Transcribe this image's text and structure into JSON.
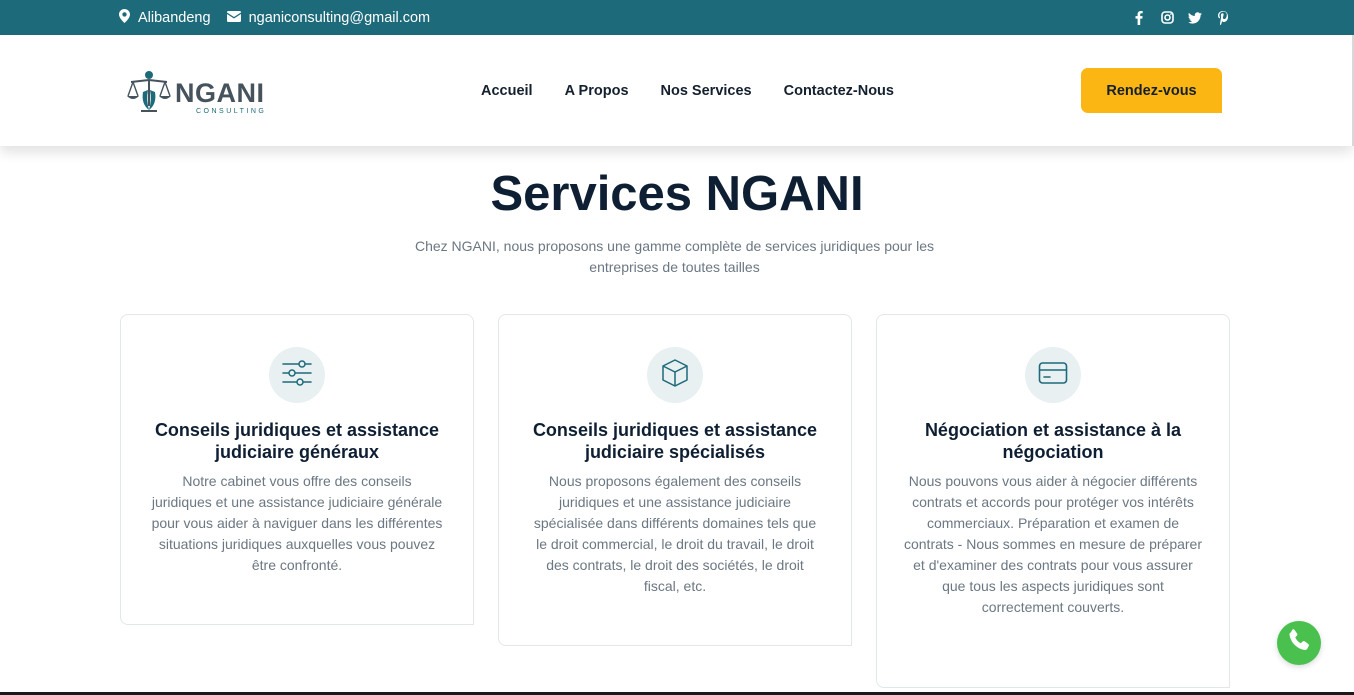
{
  "topbar": {
    "location": "Alibandeng",
    "email": "nganiconsulting@gmail.com",
    "social_icons": [
      "facebook-icon",
      "instagram-icon",
      "twitter-icon",
      "pinterest-icon"
    ]
  },
  "header": {
    "logo_name": "NGANI",
    "logo_sub": "CONSULTING",
    "nav": [
      "Accueil",
      "A Propos",
      "Nos Services",
      "Contactez-Nous"
    ],
    "cta_label": "Rendez-vous"
  },
  "main": {
    "title": "Services NGANI",
    "intro": "Chez NGANI, nous proposons une gamme complète de services juridiques pour les entreprises de toutes tailles"
  },
  "cards": [
    {
      "icon": "sliders-icon",
      "title": "Conseils juridiques et assistance judiciaire généraux",
      "text": "Notre cabinet vous offre des conseils juridiques et une assistance judiciaire générale pour vous aider à naviguer dans les différentes situations juridiques auxquelles vous pouvez être confronté."
    },
    {
      "icon": "box-icon",
      "title": "Conseils juridiques et assistance judiciaire spécialisés",
      "text": "Nous proposons également des conseils juridiques et une assistance judiciaire spécialisée dans différents domaines tels que le droit commercial, le droit du travail, le droit des contrats, le droit des sociétés, le droit fiscal, etc."
    },
    {
      "icon": "credit-card-icon",
      "title": "Négociation et assistance à la négociation",
      "text": "Nous pouvons vous aider à négocier différents contrats et accords pour protéger vos intérêts commerciaux. Préparation et examen de contrats - Nous sommes en mesure de préparer et d'examiner des contrats pour vous assurer que tous les aspects juridiques sont correctement couverts."
    }
  ],
  "colors": {
    "topbar": "#1d6a7a",
    "accent": "#fbb614",
    "whatsapp": "#4ac04f"
  }
}
